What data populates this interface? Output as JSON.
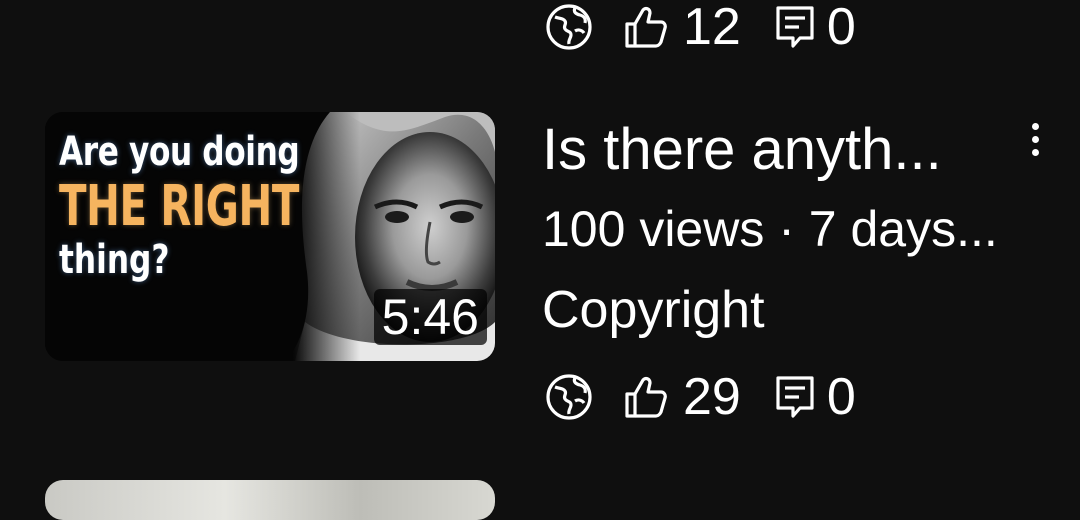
{
  "previous_item": {
    "stats": {
      "likes": "12",
      "comments": "0"
    }
  },
  "video": {
    "thumbnail": {
      "line1": "Are you doing",
      "line2": "THE RIGHT",
      "line3": "thing?",
      "duration": "5:46"
    },
    "title": "Is there anyth...",
    "meta": "100 views · 7 days...",
    "visibility": "Copyright",
    "stats": {
      "likes": "29",
      "comments": "0"
    }
  },
  "icons": {
    "visibility": "globe-icon",
    "likes": "thumbs-up-icon",
    "comments": "comment-icon",
    "menu": "more-vertical-icon"
  },
  "colors": {
    "background": "#0f0f0f",
    "text": "#ffffff",
    "thumbnail_accent": "#f6b45f"
  }
}
